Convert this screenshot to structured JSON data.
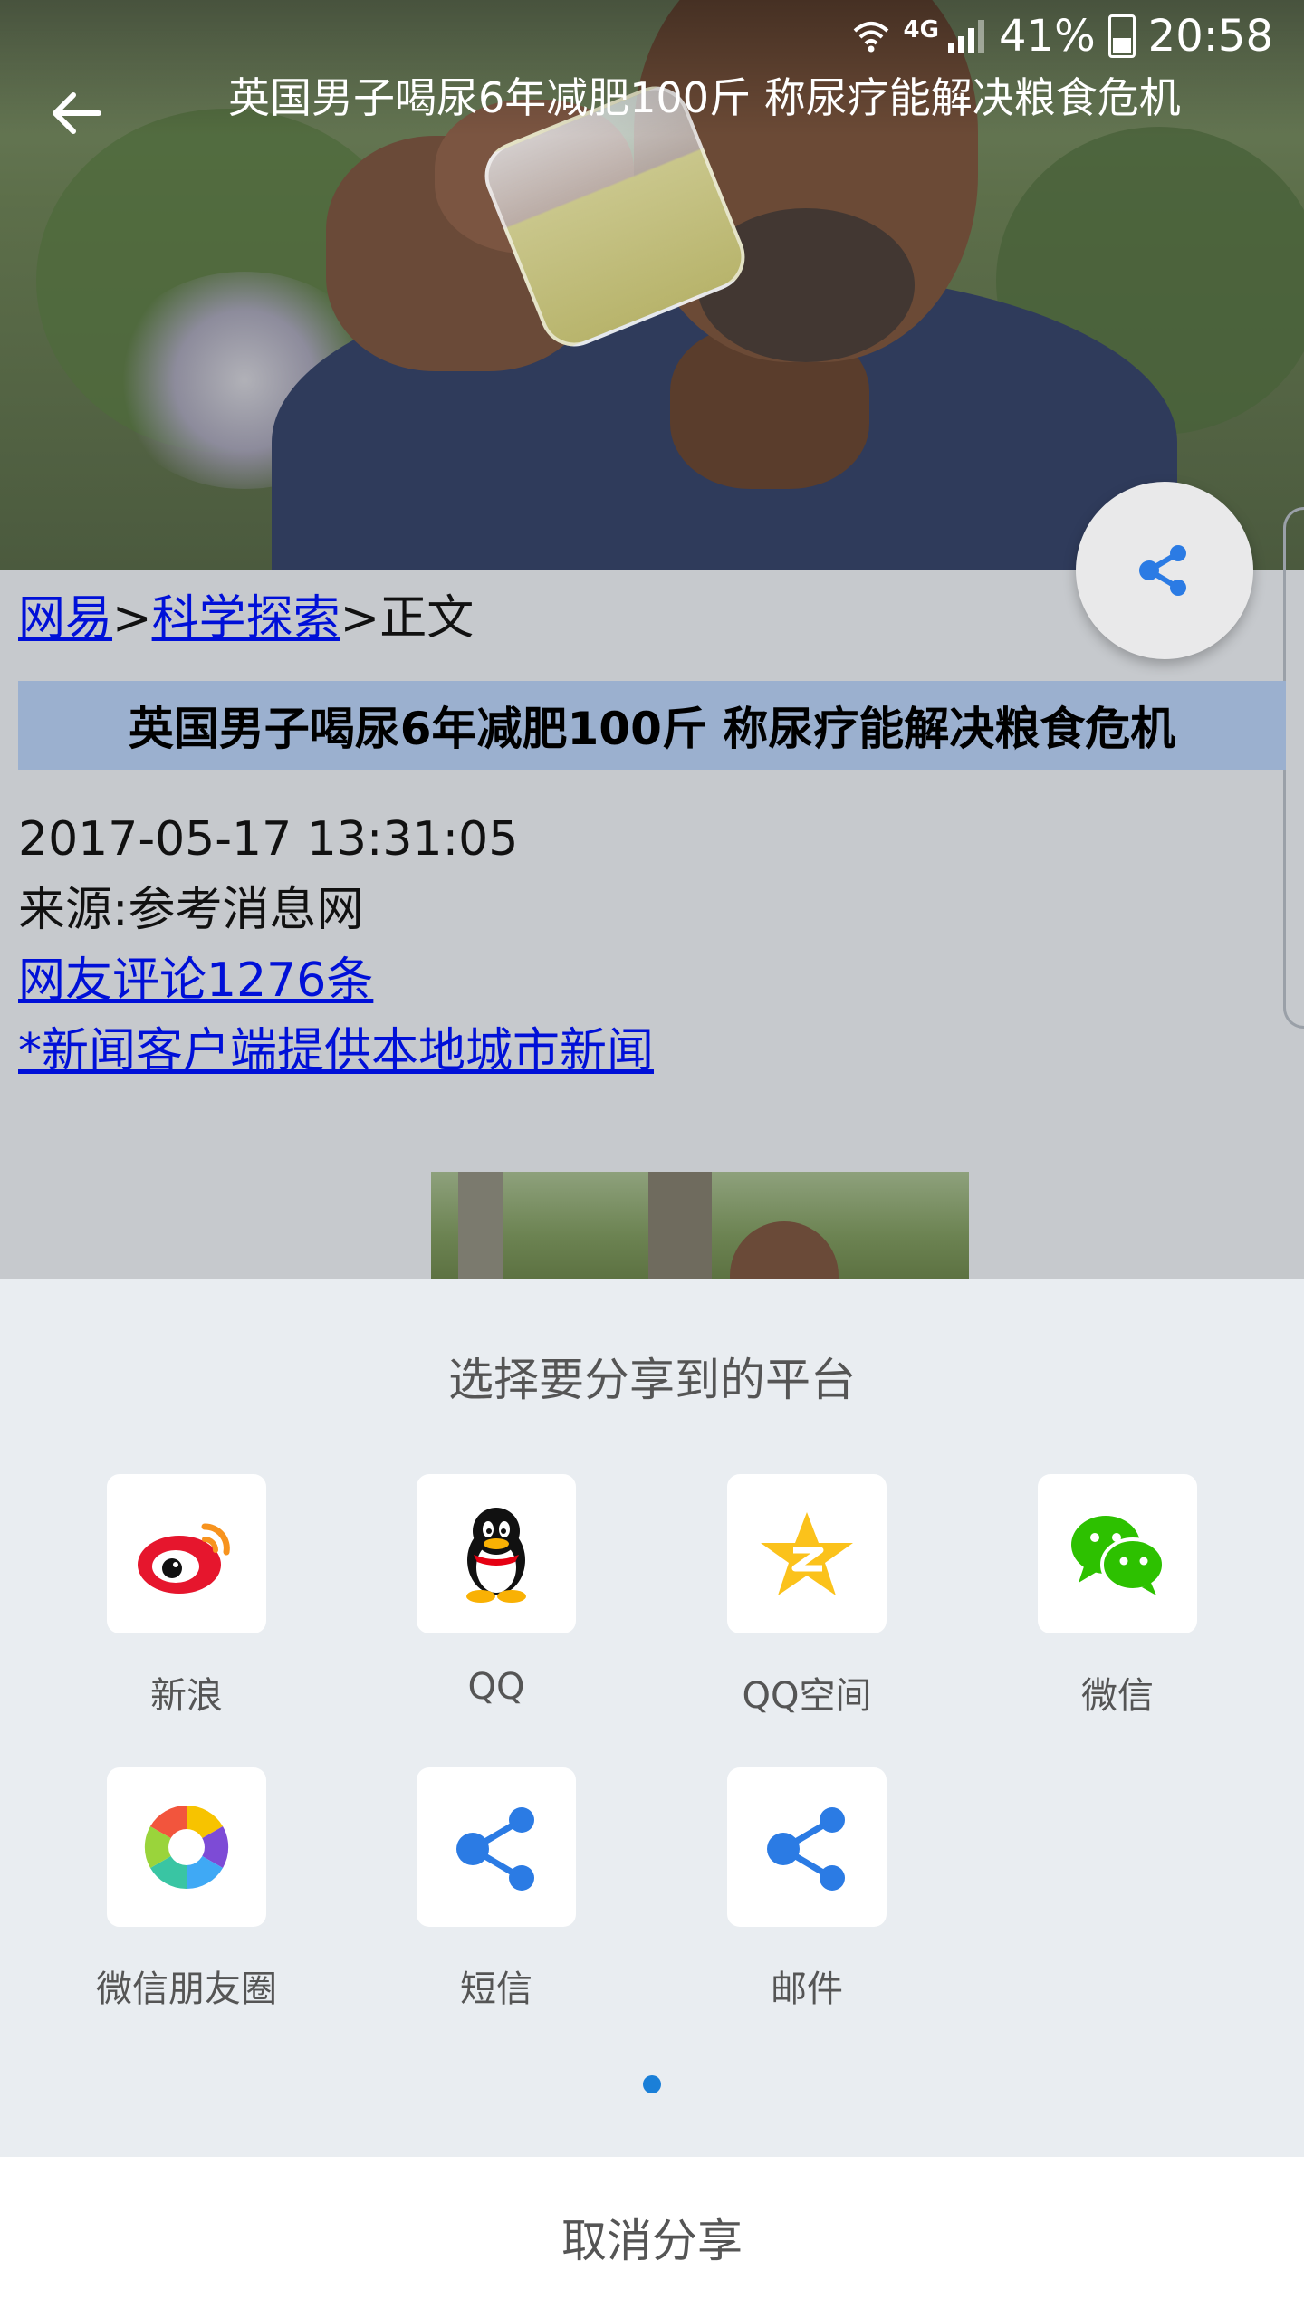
{
  "status_bar": {
    "network": "4G",
    "battery": "41%",
    "time": "20:58"
  },
  "app_bar": {
    "title": "英国男子喝尿6年减肥100斤 称尿疗能解决粮食危机"
  },
  "article": {
    "breadcrumb": {
      "site": "网易",
      "sep1": ">",
      "section": "科学探索",
      "sep2": ">",
      "current": "正文"
    },
    "headline": "英国男子喝尿6年减肥100斤 称尿疗能解决粮食危机",
    "datetime": "2017-05-17 13:31:05",
    "source": "来源:参考消息网",
    "comments_link": "网友评论1276条",
    "promo_link": "*新闻客户端提供本地城市新闻"
  },
  "share_sheet": {
    "title": "选择要分享到的平台",
    "platforms": [
      {
        "label": "新浪",
        "icon": "weibo-icon"
      },
      {
        "label": "QQ",
        "icon": "qq-icon"
      },
      {
        "label": "QQ空间",
        "icon": "qzone-icon"
      },
      {
        "label": "微信",
        "icon": "wechat-icon"
      },
      {
        "label": "微信朋友圈",
        "icon": "moments-icon"
      },
      {
        "label": "短信",
        "icon": "share-icon"
      },
      {
        "label": "邮件",
        "icon": "share-icon"
      }
    ],
    "page_indicator": {
      "current": 1,
      "total": 1
    },
    "cancel_label": "取消分享"
  },
  "colors": {
    "link": "#0010d8",
    "title_band": "#9bb0cf",
    "share_blue": "#2b7be4",
    "sheet_bg": "#e9edf1"
  }
}
